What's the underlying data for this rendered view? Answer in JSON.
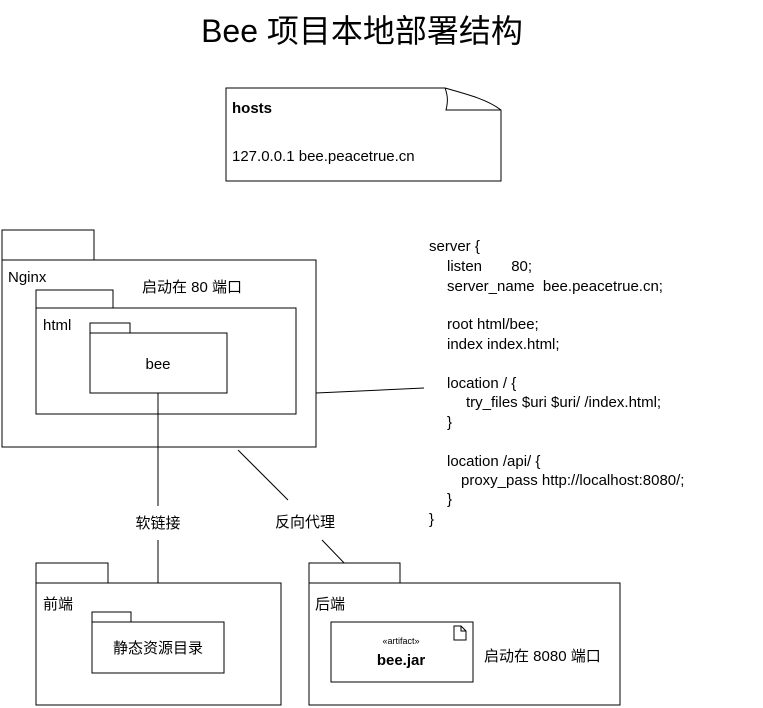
{
  "title": "Bee 项目本地部署结构",
  "hosts": {
    "title": "hosts",
    "entry": "127.0.0.1 bee.peacetrue.cn"
  },
  "nginx": {
    "label": "Nginx",
    "note": "启动在 80 端口",
    "html_label": "html",
    "bee_label": "bee"
  },
  "server_config": [
    "server {",
    "listen       80;",
    "server_name  bee.peacetrue.cn;",
    "root html/bee;",
    "index index.html;",
    "location / {",
    "try_files $uri $uri/ /index.html;",
    "}",
    "location /api/ {",
    "proxy_pass http://localhost:8080/;",
    "}",
    "}"
  ],
  "edges": {
    "symlink": "软链接",
    "reverse_proxy": "反向代理"
  },
  "frontend": {
    "label": "前端",
    "folder_label": "静态资源目录"
  },
  "backend": {
    "label": "后端",
    "stereotype": "«artifact»",
    "artifact_label": "bee.jar",
    "note": "启动在 8080 端口"
  }
}
